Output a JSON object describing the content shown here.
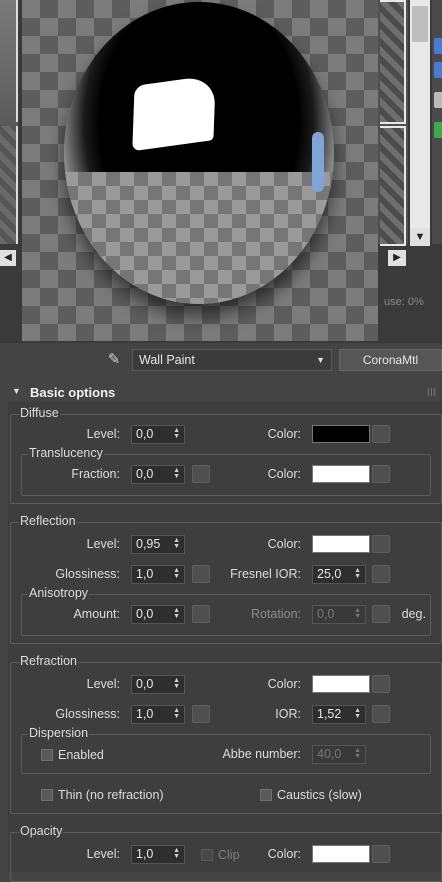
{
  "preview": {
    "stat_text": "use:     0%"
  },
  "toolbar": {
    "material_name": "Wall Paint",
    "dropdown_arrow": "▼",
    "material_type": "CoronaMtl",
    "eyedropper_icon": "eyedropper-icon"
  },
  "rollout": {
    "collapse_glyph": "▼",
    "title": "Basic options"
  },
  "diffuse": {
    "title": "Diffuse",
    "level_label": "Level:",
    "level_value": "0,0",
    "color_label": "Color:",
    "color": "#000000",
    "translucency": {
      "title": "Translucency",
      "fraction_label": "Fraction:",
      "fraction_value": "0,0",
      "color_label": "Color:",
      "color": "#ffffff"
    }
  },
  "reflection": {
    "title": "Reflection",
    "level_label": "Level:",
    "level_value": "0,95",
    "color_label": "Color:",
    "color": "#ffffff",
    "glossiness_label": "Glossiness:",
    "glossiness_value": "1,0",
    "fresnel_label": "Fresnel IOR:",
    "fresnel_value": "25,0",
    "anisotropy": {
      "title": "Anisotropy",
      "amount_label": "Amount:",
      "amount_value": "0,0",
      "rotation_label": "Rotation:",
      "rotation_value": "0,0",
      "unit": "deg."
    }
  },
  "refraction": {
    "title": "Refraction",
    "level_label": "Level:",
    "level_value": "0,0",
    "color_label": "Color:",
    "color": "#ffffff",
    "glossiness_label": "Glossiness:",
    "glossiness_value": "1,0",
    "ior_label": "IOR:",
    "ior_value": "1,52",
    "dispersion": {
      "title": "Dispersion",
      "enabled_label": "Enabled",
      "abbe_label": "Abbe number:",
      "abbe_value": "40,0"
    },
    "thin_label": "Thin (no refraction)",
    "caustics_label": "Caustics (slow)"
  },
  "opacity": {
    "title": "Opacity",
    "level_label": "Level:",
    "level_value": "1,0",
    "clip_label": "Clip",
    "color_label": "Color:",
    "color": "#ffffff"
  },
  "spinner_arrows": "▲▼"
}
